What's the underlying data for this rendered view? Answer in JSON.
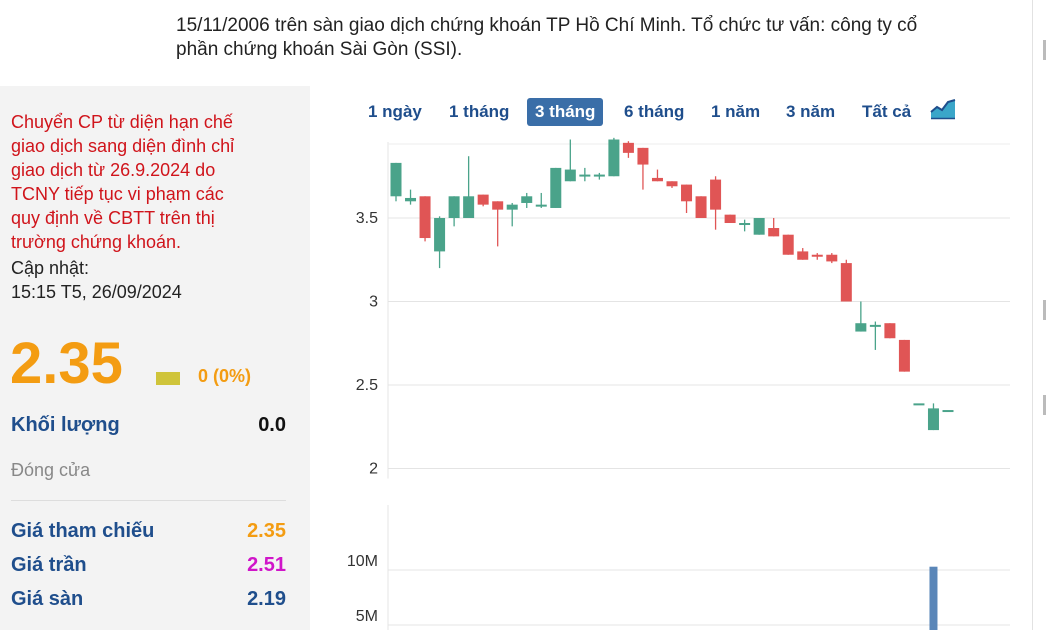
{
  "description": {
    "line1": "15/11/2006 trên sàn giao dịch chứng khoán TP Hồ Chí Minh. Tổ chức tư vấn: công ty cổ",
    "line2": "phần chứng khoán Sài Gòn (SSI)."
  },
  "notice": {
    "lines": [
      "Chuyển CP từ diện hạn chế",
      "giao dịch sang diện đình chỉ",
      "giao dịch từ 26.9.2024 do",
      "TCNY tiếp tục vi phạm các",
      "quy định về CBTT trên thị",
      "trường chứng khoán."
    ]
  },
  "update": {
    "label": "Cập nhật:",
    "time": "15:15 T5, 26/09/2024"
  },
  "price": {
    "value": "2.35",
    "change": "0 (0%)"
  },
  "volume": {
    "label": "Khối lượng",
    "value": "0.0"
  },
  "status": "Đóng cửa",
  "stats": [
    {
      "label": "Giá tham chiếu",
      "value": "2.35",
      "color": "#f39c12"
    },
    {
      "label": "Giá trần",
      "value": "2.51",
      "color": "#d015c9"
    },
    {
      "label": "Giá sàn",
      "value": "2.19",
      "color": "#1f4e8c"
    }
  ],
  "colors": {
    "up": "#4aa38a",
    "down": "#e05555",
    "accent": "#f39c12",
    "volume": "#5a86b8"
  },
  "tabs": [
    "1 ngày",
    "1 tháng",
    "3 tháng",
    "6 tháng",
    "1 năm",
    "3 năm",
    "Tất cả"
  ],
  "active_tab": "3 tháng",
  "chart_icon": "area-chart-icon",
  "chart_data": [
    {
      "type": "candlestick",
      "y_ticks": [
        "3.5",
        "3",
        "2.5",
        "2"
      ],
      "ylim": [
        1.95,
        3.95
      ],
      "grid": true,
      "candles": [
        {
          "o": 3.63,
          "h": 3.83,
          "l": 3.6,
          "c": 3.83
        },
        {
          "o": 3.6,
          "h": 3.67,
          "l": 3.58,
          "c": 3.62
        },
        {
          "o": 3.63,
          "h": 3.63,
          "l": 3.36,
          "c": 3.38
        },
        {
          "o": 3.3,
          "h": 3.51,
          "l": 3.2,
          "c": 3.5
        },
        {
          "o": 3.5,
          "h": 3.63,
          "l": 3.45,
          "c": 3.63
        },
        {
          "o": 3.5,
          "h": 3.87,
          "l": 3.5,
          "c": 3.63
        },
        {
          "o": 3.64,
          "h": 3.64,
          "l": 3.57,
          "c": 3.58
        },
        {
          "o": 3.6,
          "h": 3.6,
          "l": 3.33,
          "c": 3.55
        },
        {
          "o": 3.55,
          "h": 3.59,
          "l": 3.45,
          "c": 3.58
        },
        {
          "o": 3.59,
          "h": 3.65,
          "l": 3.56,
          "c": 3.63
        },
        {
          "o": 3.58,
          "h": 3.65,
          "l": 3.56,
          "c": 3.58
        },
        {
          "o": 3.56,
          "h": 3.8,
          "l": 3.56,
          "c": 3.8
        },
        {
          "o": 3.72,
          "h": 3.97,
          "l": 3.72,
          "c": 3.79
        },
        {
          "o": 3.76,
          "h": 3.8,
          "l": 3.72,
          "c": 3.76
        },
        {
          "o": 3.75,
          "h": 3.77,
          "l": 3.73,
          "c": 3.76
        },
        {
          "o": 3.75,
          "h": 3.98,
          "l": 3.75,
          "c": 3.97
        },
        {
          "o": 3.95,
          "h": 3.96,
          "l": 3.86,
          "c": 3.89
        },
        {
          "o": 3.92,
          "h": 3.92,
          "l": 3.67,
          "c": 3.82
        },
        {
          "o": 3.74,
          "h": 3.79,
          "l": 3.72,
          "c": 3.72
        },
        {
          "o": 3.72,
          "h": 3.72,
          "l": 3.68,
          "c": 3.69
        },
        {
          "o": 3.7,
          "h": 3.7,
          "l": 3.53,
          "c": 3.6
        },
        {
          "o": 3.63,
          "h": 3.63,
          "l": 3.5,
          "c": 3.5
        },
        {
          "o": 3.73,
          "h": 3.75,
          "l": 3.43,
          "c": 3.55
        },
        {
          "o": 3.52,
          "h": 3.52,
          "l": 3.47,
          "c": 3.47
        },
        {
          "o": 3.47,
          "h": 3.49,
          "l": 3.42,
          "c": 3.47
        },
        {
          "o": 3.4,
          "h": 3.5,
          "l": 3.4,
          "c": 3.5
        },
        {
          "o": 3.44,
          "h": 3.5,
          "l": 3.39,
          "c": 3.39
        },
        {
          "o": 3.4,
          "h": 3.4,
          "l": 3.28,
          "c": 3.28
        },
        {
          "o": 3.3,
          "h": 3.32,
          "l": 3.25,
          "c": 3.25
        },
        {
          "o": 3.28,
          "h": 3.29,
          "l": 3.25,
          "c": 3.27
        },
        {
          "o": 3.28,
          "h": 3.29,
          "l": 3.23,
          "c": 3.24
        },
        {
          "o": 3.23,
          "h": 3.25,
          "l": 3.0,
          "c": 3.0
        },
        {
          "o": 2.82,
          "h": 3.0,
          "l": 2.82,
          "c": 2.87
        },
        {
          "o": 2.86,
          "h": 2.88,
          "l": 2.71,
          "c": 2.86
        },
        {
          "o": 2.87,
          "h": 2.87,
          "l": 2.78,
          "c": 2.78
        },
        {
          "o": 2.77,
          "h": 2.77,
          "l": 2.58,
          "c": 2.58
        },
        {
          "o": 2.39,
          "h": 2.39,
          "l": 2.39,
          "c": 2.39
        },
        {
          "o": 2.23,
          "h": 2.39,
          "l": 2.23,
          "c": 2.36
        },
        {
          "o": 2.35,
          "h": 2.35,
          "l": 2.35,
          "c": 2.35
        }
      ]
    },
    {
      "type": "bar",
      "y_ticks": [
        "10M",
        "5M"
      ],
      "bars": [
        {
          "index": 32,
          "value": 4500000
        },
        {
          "index": 37,
          "value": 10300000
        }
      ]
    }
  ]
}
